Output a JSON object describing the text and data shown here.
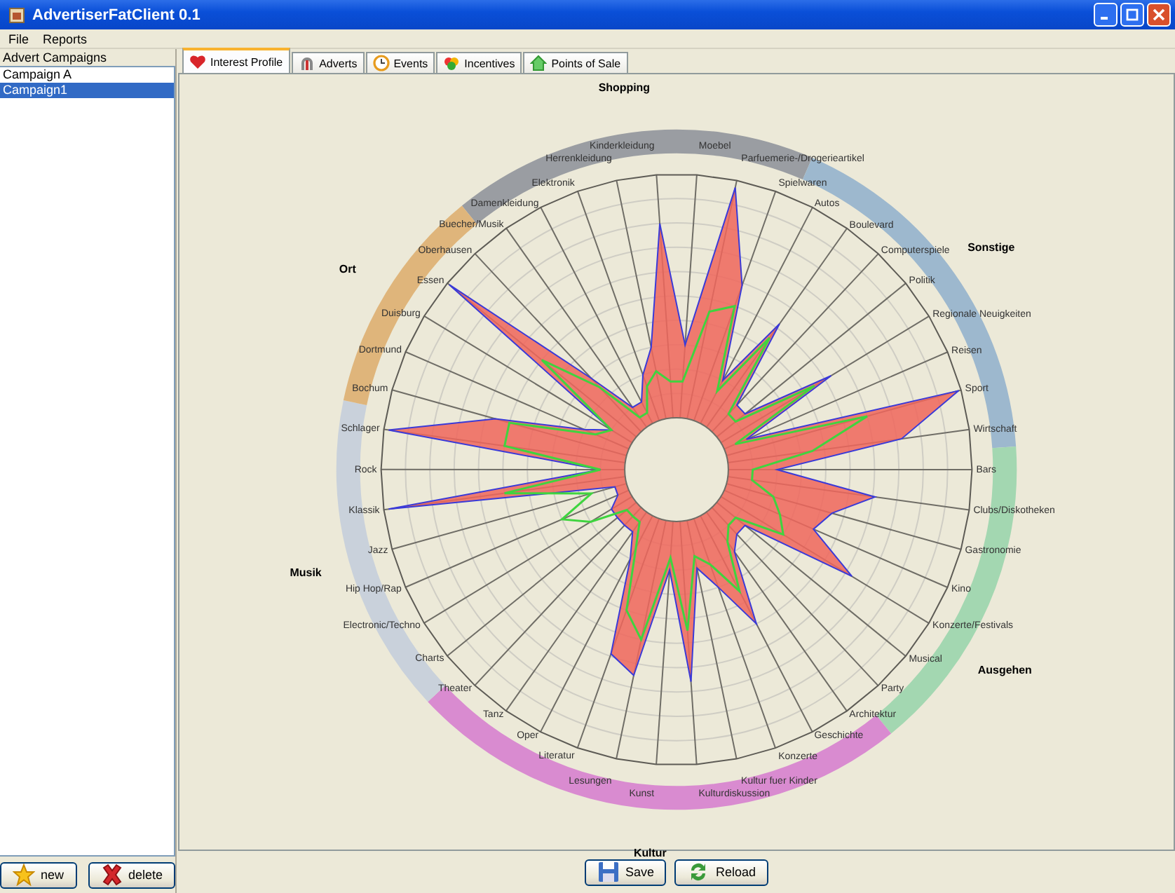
{
  "window": {
    "title": "AdvertiserFatClient 0.1"
  },
  "menu": [
    "File",
    "Reports"
  ],
  "sidebar": {
    "title": "Advert Campaigns",
    "campaigns": [
      {
        "label": "Campaign A",
        "selected": false
      },
      {
        "label": "Campaign1",
        "selected": true
      }
    ],
    "buttons": [
      "new",
      "delete"
    ]
  },
  "tabs": [
    {
      "label": "Interest Profile",
      "selected": true
    },
    {
      "label": "Adverts",
      "selected": false
    },
    {
      "label": "Events",
      "selected": false
    },
    {
      "label": "Incentives",
      "selected": false
    },
    {
      "label": "Points of Sale",
      "selected": false
    }
  ],
  "interest_profile": {
    "groups": [
      {
        "name": "Shopping",
        "color": "#9a9da2",
        "axes": [
          "Kinderkleidung",
          "Moebel",
          "Herrenkleidung",
          "Parfuemerie-/Drogerieartikel",
          "Elektronik",
          "Spielwaren",
          "Damenkleidung",
          "Buecher/Musik"
        ]
      },
      {
        "name": "Sonstige",
        "color": "#9db8ce",
        "axes": [
          "Autos",
          "Boulevard",
          "Computerspiele",
          "Politik",
          "Regionale Neuigkeiten",
          "Reisen",
          "Sport",
          "Wirtschaft"
        ]
      },
      {
        "name": "Ausgehen",
        "color": "#a3d7b1",
        "axes": [
          "Bars",
          "Clubs/Diskotheken",
          "Gastronomie",
          "Kino",
          "Konzerte/Festivals",
          "Musical",
          "Party"
        ]
      },
      {
        "name": "Kultur",
        "color": "#d98bd0",
        "axes": [
          "Architektur",
          "Geschichte",
          "Konzerte",
          "Kultur fuer Kinder",
          "Kulturdiskussion",
          "Kunst",
          "Lesungen",
          "Literatur",
          "Oper",
          "Tanz",
          "Theater"
        ]
      },
      {
        "name": "Musik",
        "color": "#c9d1db",
        "axes": [
          "Schlager",
          "Rock",
          "Klassik",
          "Jazz",
          "Hip Hop/Rap",
          "Electronic/Techno",
          "Charts"
        ]
      },
      {
        "name": "Ort",
        "color": "#dfb57b",
        "axes": [
          "Oberhausen",
          "Essen",
          "Duisburg",
          "Dortmund",
          "Bochum"
        ]
      }
    ]
  },
  "buttons": [
    "Save",
    "Reload"
  ]
}
